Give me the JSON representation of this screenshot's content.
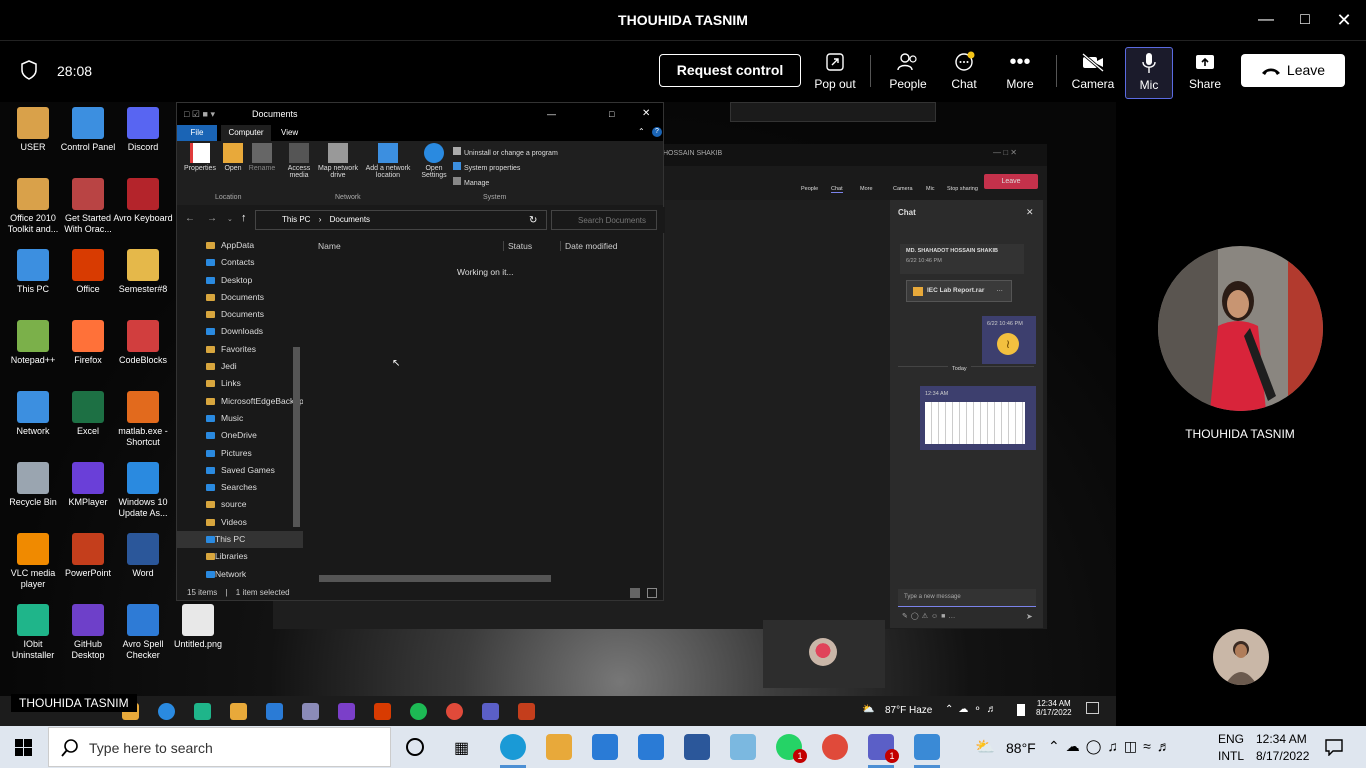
{
  "window": {
    "title": "THOUHIDA TASNIM"
  },
  "toolbar": {
    "timer": "28:08",
    "request_control": "Request control",
    "pop_out": "Pop out",
    "people": "People",
    "chat": "Chat",
    "more": "More",
    "camera": "Camera",
    "mic": "Mic",
    "share": "Share",
    "leave": "Leave"
  },
  "participants": {
    "main_name": "THOUHIDA TASNIM",
    "presenter_tag": "THOUHIDA TASNIM"
  },
  "desktop": {
    "icons": [
      {
        "label": "USER",
        "color": "#d9a14a"
      },
      {
        "label": "Control Panel",
        "color": "#3c8fe0"
      },
      {
        "label": "Discord",
        "color": "#5865f2"
      },
      {
        "label": "Office 2010 Toolkit and...",
        "color": "#d9a14a"
      },
      {
        "label": "Get Started With Orac...",
        "color": "#b94444"
      },
      {
        "label": "Avro Keyboard",
        "color": "#b4242b"
      },
      {
        "label": "This PC",
        "color": "#3c8fe0"
      },
      {
        "label": "Office",
        "color": "#d83b01"
      },
      {
        "label": "Semester#8",
        "color": "#e5b84a"
      },
      {
        "label": "Notepad++",
        "color": "#7bb04a"
      },
      {
        "label": "Firefox",
        "color": "#ff7139"
      },
      {
        "label": "CodeBlocks",
        "color": "#d13e3e"
      },
      {
        "label": "Network",
        "color": "#3c8fe0"
      },
      {
        "label": "Excel",
        "color": "#1d7044"
      },
      {
        "label": "matlab.exe - Shortcut",
        "color": "#e26a1d"
      },
      {
        "label": "Recycle Bin",
        "color": "#9aa5b0"
      },
      {
        "label": "KMPlayer",
        "color": "#6a3fd8"
      },
      {
        "label": "Windows 10 Update As...",
        "color": "#2a8ae0"
      },
      {
        "label": "VLC media player",
        "color": "#f08a00"
      },
      {
        "label": "PowerPoint",
        "color": "#c43e1c"
      },
      {
        "label": "Word",
        "color": "#2b579a"
      },
      {
        "label": "IObit Uninstaller",
        "color": "#1fb58a"
      },
      {
        "label": "GitHub Desktop",
        "color": "#6e40c9"
      },
      {
        "label": "Avro Spell Checker",
        "color": "#2e7bd6"
      },
      {
        "label": "Untitled.png",
        "color": "#e8e8e8"
      }
    ]
  },
  "explorer": {
    "title": "Documents",
    "tabs": [
      "File",
      "Computer",
      "View"
    ],
    "ribbon": {
      "properties": "Properties",
      "open": "Open",
      "rename": "Rename",
      "access_media": "Access media",
      "map_network": "Map network drive",
      "add_network": "Add a network location",
      "open_settings": "Open Settings",
      "uninstall": "Uninstall or change a program",
      "system_properties": "System properties",
      "manage": "Manage",
      "group_location": "Location",
      "group_network": "Network",
      "group_system": "System"
    },
    "breadcrumb": [
      "This PC",
      "Documents"
    ],
    "search_placeholder": "Search Documents",
    "nav": [
      "AppData",
      "Contacts",
      "Desktop",
      "Documents",
      "Documents",
      "Downloads",
      "Favorites",
      "Jedi",
      "Links",
      "MicrosoftEdgeBackups",
      "Music",
      "OneDrive",
      "Pictures",
      "Saved Games",
      "Searches",
      "source",
      "Videos",
      "This PC",
      "Libraries",
      "Network"
    ],
    "columns": [
      "Name",
      "Status",
      "Date modified"
    ],
    "loading": "Working on it...",
    "status_items": "15 items",
    "status_selected": "1 item selected"
  },
  "teams_inner": {
    "caption": "HOSSAIN SHAKIB",
    "toolbar": [
      "People",
      "Chat",
      "More",
      "Camera",
      "Mic",
      "Stop sharing"
    ],
    "leave": "Leave",
    "chat_title": "Chat",
    "sender": "MD. SHAHADOT HOSSAIN SHAKIB",
    "sender_time": "6/22 10:46 PM",
    "file_name": "IEC Lab Report.rar",
    "my_time": "6/22 10:46 PM",
    "today": "Today",
    "img_time": "12:34 AM",
    "compose_placeholder": "Type a new message"
  },
  "inner_taskbar": {
    "weather": "87°F Haze",
    "time": "12:34 AM",
    "date": "8/17/2022"
  },
  "taskbar": {
    "search_placeholder": "Type here to search",
    "weather": "88°F",
    "lang1": "ENG",
    "lang2": "INTL",
    "time": "12:34 AM",
    "date": "8/17/2022",
    "whatsapp_badge": "1",
    "teams_badge": "1"
  }
}
